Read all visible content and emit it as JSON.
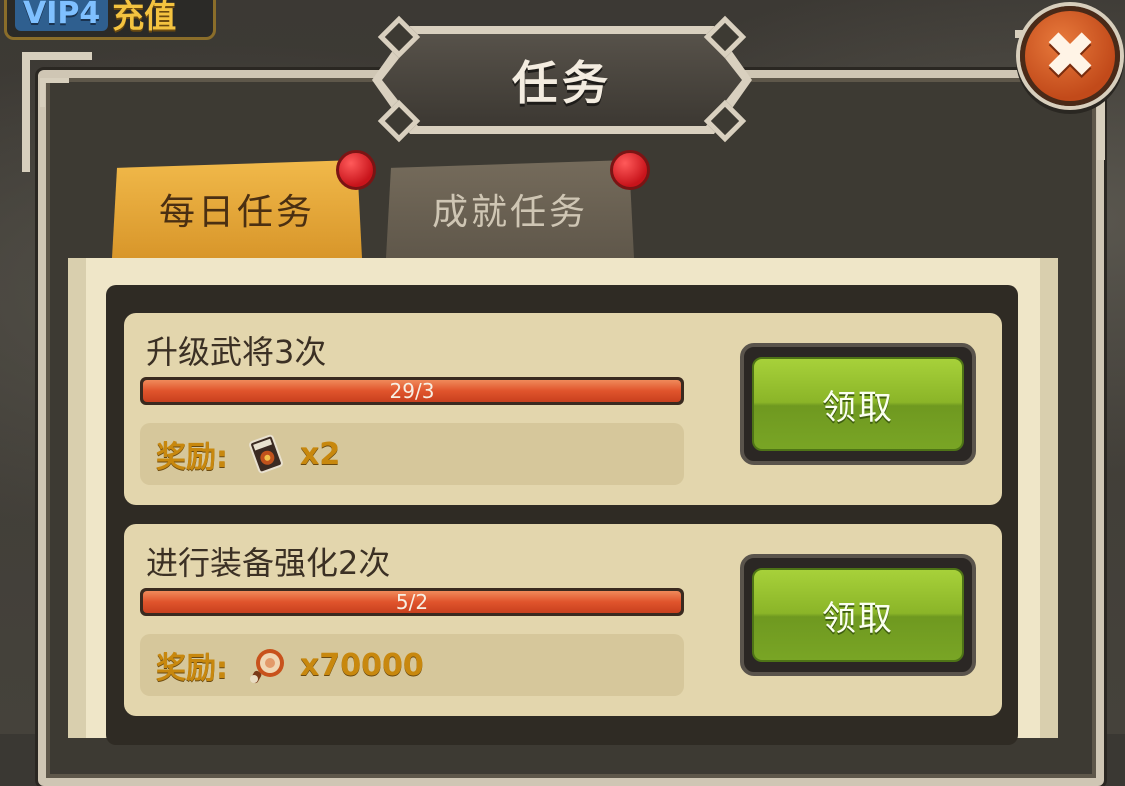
{
  "top_bar": {
    "vip_label": "VIP4",
    "recharge_label": "充值"
  },
  "dialog": {
    "title": "任务",
    "close_symbol": "✖"
  },
  "tabs": [
    {
      "label": "每日任务",
      "active": true,
      "has_notification": true
    },
    {
      "label": "成就任务",
      "active": false,
      "has_notification": true
    }
  ],
  "tasks": [
    {
      "title": "升级武将3次",
      "progress_text": "29/3",
      "progress_fraction": 1.0,
      "reward_label": "奖励:",
      "reward_icon": "book-icon",
      "reward_count": "x2",
      "claim_label": "领取"
    },
    {
      "title": "进行装备强化2次",
      "progress_text": "5/2",
      "progress_fraction": 1.0,
      "reward_label": "奖励:",
      "reward_icon": "meat-icon",
      "reward_count": "x70000",
      "claim_label": "领取"
    }
  ],
  "colors": {
    "tab_active": "#e4a63a",
    "progress_fill": "#e0542c",
    "claim_button": "#8bb528",
    "reward_text": "#c8880e",
    "notification_dot": "#d8141b"
  }
}
